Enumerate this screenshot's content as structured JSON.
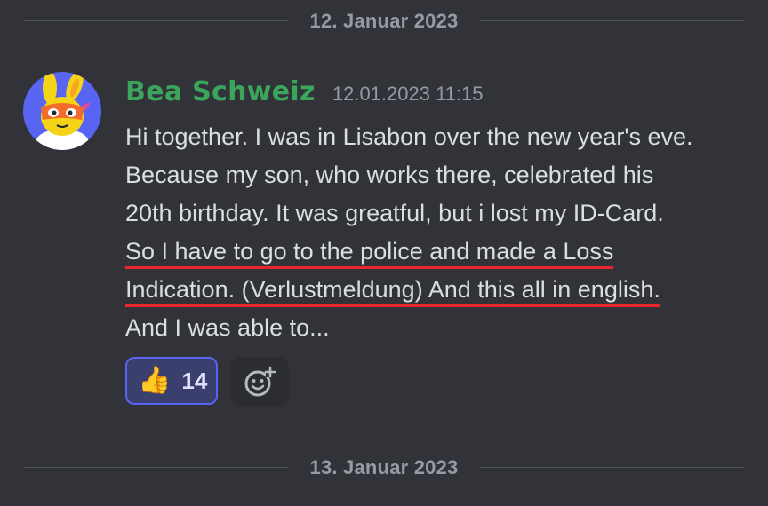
{
  "dividers": {
    "top": "12. Januar 2023",
    "bottom": "13. Januar 2023"
  },
  "message": {
    "author": "Bea Schweiz",
    "timestamp": "12.01.2023 11:15",
    "lines": [
      "Hi together. I was in Lisabon over the new year's eve.",
      "Because my son, who works there, celebrated his",
      "20th birthday. It was greatful, but i lost my ID-Card.",
      "So I have to go to the police and made a Loss",
      "Indication. (Verlustmeldung)  And this all in english.",
      "And  I was able to..."
    ],
    "avatar_icon": "yellow-bunny-with-sunglasses-avatar"
  },
  "reactions": [
    {
      "emoji": "👍",
      "emoji_name": "thumbs-up-icon",
      "count": "14"
    }
  ],
  "add_reaction_icon": "add-reaction-smiley-icon",
  "colors": {
    "background": "#313338",
    "username": "#3ba55c",
    "underline": "#e8262b",
    "reaction_border": "#5865f2"
  }
}
